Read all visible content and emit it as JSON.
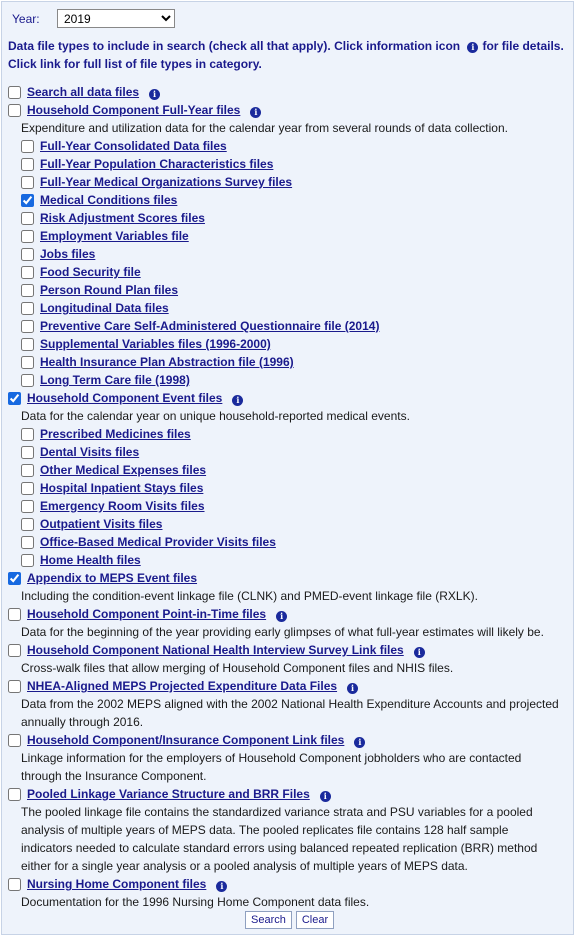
{
  "year": {
    "label": "Year:",
    "selected": "2019"
  },
  "intro": {
    "line1_pre": "Data file types to include in search (check all that apply). Click information icon",
    "line1_post": "for file details.",
    "line2": "Click link for full list of file types in category."
  },
  "info_icon_glyph": "i",
  "categories": {
    "search_all": {
      "label": "Search all data files",
      "checked": false
    },
    "hc_full_year": {
      "label": "Household Component Full-Year files",
      "checked": false,
      "desc": "Expenditure and utilization data for the calendar year from several rounds of data collection."
    },
    "hc_event": {
      "label": "Household Component Event files",
      "checked": true,
      "desc": "Data for the calendar year on unique household-reported medical events."
    },
    "appendix": {
      "label": "Appendix to MEPS Event files",
      "checked": true,
      "desc": "Including the condition-event linkage file (CLNK) and PMED-event linkage file (RXLK)."
    },
    "point_in_time": {
      "label": "Household Component Point-in-Time files",
      "checked": false,
      "desc": "Data for the beginning of the year providing early glimpses of what full-year estimates will likely be."
    },
    "nhis_link": {
      "label": "Household Component National Health Interview Survey Link files",
      "checked": false,
      "desc": "Cross-walk files that allow merging of Household Component files and NHIS files."
    },
    "nhea": {
      "label": "NHEA-Aligned MEPS Projected Expenditure Data Files",
      "checked": false,
      "desc": "Data from the 2002 MEPS aligned with the 2002 National Health Expenditure Accounts and projected annually through 2016."
    },
    "ic_link": {
      "label": "Household Component/Insurance Component Link files",
      "checked": false,
      "desc": "Linkage information for the employers of Household Component jobholders who are contacted through the Insurance Component."
    },
    "pooled": {
      "label": "Pooled Linkage Variance Structure and BRR Files",
      "checked": false,
      "desc": "The pooled linkage file contains the standardized variance strata and PSU variables for a pooled analysis of multiple years of MEPS data. The pooled replicates file contains 128 half sample indicators needed to calculate standard errors using balanced repeated replication (BRR) method either for a single year analysis or a pooled analysis of multiple years of MEPS data."
    },
    "nursing": {
      "label": "Nursing Home Component files",
      "checked": false,
      "desc": "Documentation for the 1996 Nursing Home Component data files."
    }
  },
  "full_year_files": [
    {
      "label": "Full-Year Consolidated Data files",
      "checked": false
    },
    {
      "label": "Full-Year Population Characteristics files",
      "checked": false
    },
    {
      "label": "Full-Year Medical Organizations Survey files",
      "checked": false
    },
    {
      "label": "Medical Conditions files",
      "checked": true
    },
    {
      "label": "Risk Adjustment Scores files",
      "checked": false
    },
    {
      "label": "Employment Variables file",
      "checked": false
    },
    {
      "label": "Jobs files",
      "checked": false
    },
    {
      "label": "Food Security file",
      "checked": false
    },
    {
      "label": "Person Round Plan files",
      "checked": false
    },
    {
      "label": "Longitudinal Data files",
      "checked": false
    },
    {
      "label": "Preventive Care Self-Administered Questionnaire file (2014)",
      "checked": false
    },
    {
      "label": "Supplemental Variables files (1996-2000)",
      "checked": false
    },
    {
      "label": "Health Insurance Plan Abstraction file (1996)",
      "checked": false
    },
    {
      "label": "Long Term Care file (1998)",
      "checked": false
    }
  ],
  "event_files": [
    {
      "label": "Prescribed Medicines files",
      "checked": false
    },
    {
      "label": "Dental Visits files",
      "checked": false
    },
    {
      "label": "Other Medical Expenses files",
      "checked": false
    },
    {
      "label": "Hospital Inpatient Stays files",
      "checked": false
    },
    {
      "label": "Emergency Room Visits files",
      "checked": false
    },
    {
      "label": "Outpatient Visits files",
      "checked": false
    },
    {
      "label": "Office-Based Medical Provider Visits files",
      "checked": false
    },
    {
      "label": "Home Health files",
      "checked": false
    }
  ],
  "buttons": {
    "search": "Search",
    "clear": "Clear"
  }
}
